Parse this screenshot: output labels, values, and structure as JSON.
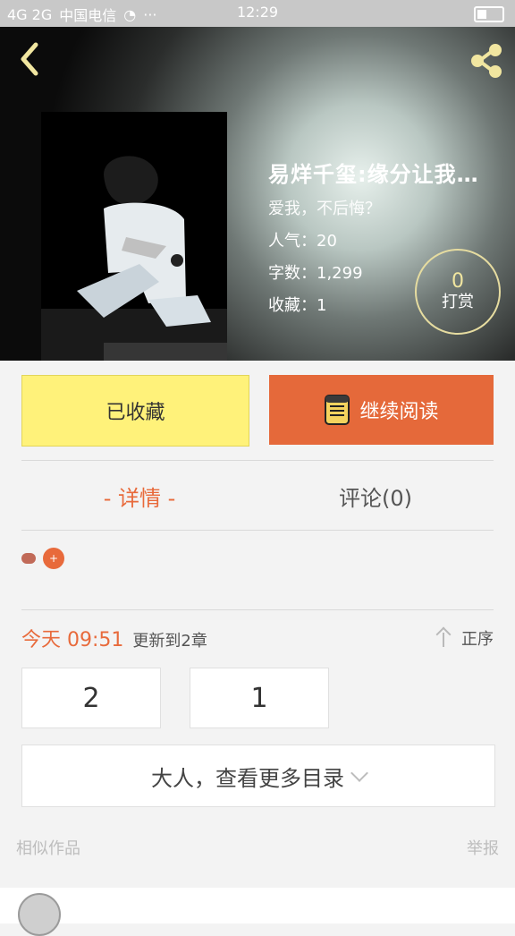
{
  "status": {
    "carrier_network": "4G 2G",
    "carrier": "中国电信",
    "time": "12:29"
  },
  "header": {
    "back_icon": "chevron-left-icon",
    "share_icon": "share-icon"
  },
  "book": {
    "title": "易烊千玺:缘分让我…",
    "subtitle": "爱我，不后悔？",
    "popularity_label": "人气：",
    "popularity_value": "20",
    "word_count_label": "字数：",
    "word_count_value": "1,299",
    "favorites_label": "收藏：",
    "favorites_value": "1"
  },
  "tip": {
    "count": "0",
    "label": "打赏"
  },
  "actions": {
    "collected_label": "已收藏",
    "continue_label": "继续阅读"
  },
  "tabs": [
    {
      "label": "- 详情 -"
    },
    {
      "label": "评论(0)"
    }
  ],
  "update": {
    "date": "今天 09:51",
    "description": "更新到2章",
    "order_label": "正序"
  },
  "chapters": [
    {
      "label": "2"
    },
    {
      "label": "1"
    }
  ],
  "more": {
    "label": "大人，查看更多目录"
  },
  "footer": {
    "similar_label": "相似作品",
    "report_label": "举报"
  },
  "colors": {
    "accent": "#e86a3b",
    "yellow": "#fff27a",
    "gold": "#f1e6a0"
  }
}
